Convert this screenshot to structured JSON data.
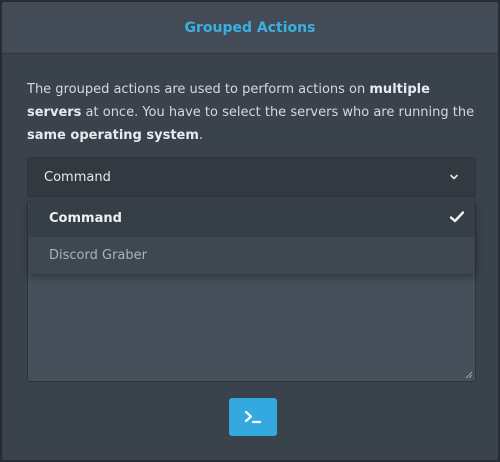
{
  "header": {
    "title": "Grouped Actions"
  },
  "description": {
    "part1": "The grouped actions are used to perform actions on ",
    "bold1": "multiple servers",
    "part2": " at once. You have to select the servers who are running the ",
    "bold2": "same operating system",
    "part3": "."
  },
  "select": {
    "selected_value": "Command",
    "chevron_icon": "chevron-down-icon"
  },
  "dropdown": {
    "options": [
      {
        "label": "Command",
        "selected": true
      },
      {
        "label": "Discord Graber",
        "selected": false
      }
    ],
    "check_icon": "check-icon"
  },
  "execute_button": {
    "icon": "terminal-icon"
  },
  "colors": {
    "accent": "#33a9e0",
    "title": "#3ab0e2",
    "panel": "#3a424b"
  }
}
